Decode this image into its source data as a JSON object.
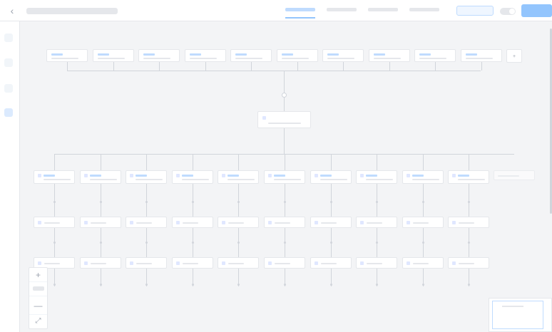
{
  "topbar": {
    "back_icon": "chevron-left-icon",
    "title": "",
    "tabs": [
      {
        "label": "",
        "active": true
      },
      {
        "label": "",
        "active": false
      },
      {
        "label": "",
        "active": false
      },
      {
        "label": "",
        "active": false
      }
    ],
    "secondary_action": "",
    "toggle_on": true,
    "primary_action": ""
  },
  "sidebar": {
    "items": [
      {
        "icon": "box-icon",
        "active": false
      },
      {
        "icon": "box-icon",
        "active": false
      },
      {
        "icon": "box-icon",
        "active": false
      },
      {
        "icon": "box-icon",
        "active": true
      }
    ]
  },
  "flow": {
    "top_nodes": 10,
    "center_node": "",
    "columns": 10,
    "add_node_symbol": "+"
  },
  "zoom_controls": {
    "zoom_in_icon": "plus-icon",
    "zoom_out_icon": "minus-icon",
    "fit_icon": "expand-icon",
    "zoom_in_symbol": "+",
    "zoom_out_symbol": "—",
    "fit_symbol": "⤢"
  },
  "colors": {
    "accent": "#93c5fd",
    "accent_light": "#bfdbfe",
    "canvas": "#f3f4f6",
    "border": "#e5e7eb"
  }
}
